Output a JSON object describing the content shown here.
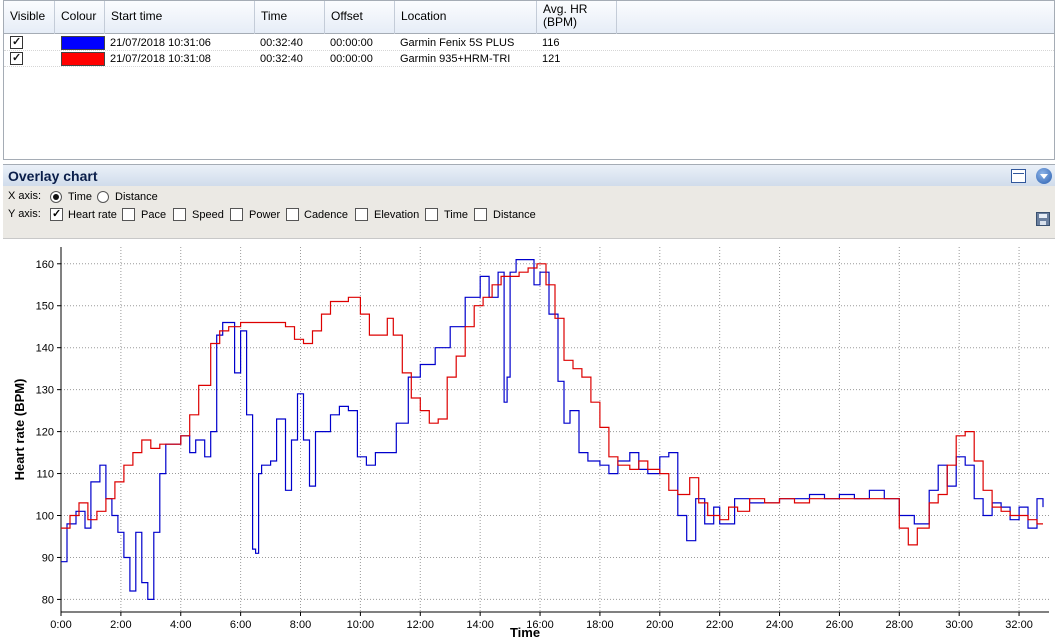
{
  "grid": {
    "columns": [
      {
        "label": "Visible"
      },
      {
        "label": "Colour"
      },
      {
        "label": "Start time"
      },
      {
        "label": "Time"
      },
      {
        "label": "Offset"
      },
      {
        "label": "Location"
      },
      {
        "label_line1": "Avg. HR",
        "label_line2": "(BPM)"
      }
    ],
    "rows": [
      {
        "visible": true,
        "colour": "#0000ff",
        "start_time": "21/07/2018 10:31:06",
        "time": "00:32:40",
        "offset": "00:00:00",
        "location": "Garmin Fenix 5S PLUS",
        "avg_hr": "116"
      },
      {
        "visible": true,
        "colour": "#ff0000",
        "start_time": "21/07/2018 10:31:08",
        "time": "00:32:40",
        "offset": "00:00:00",
        "location": "Garmin 935+HRM-TRI",
        "avg_hr": "121"
      }
    ]
  },
  "panel": {
    "title": "Overlay chart",
    "x_axis_label": "X axis:",
    "x_options": [
      {
        "label": "Time",
        "selected": true
      },
      {
        "label": "Distance",
        "selected": false
      }
    ],
    "y_axis_label": "Y axis:",
    "y_options": [
      {
        "label": "Heart rate",
        "checked": true
      },
      {
        "label": "Pace",
        "checked": false
      },
      {
        "label": "Speed",
        "checked": false
      },
      {
        "label": "Power",
        "checked": false
      },
      {
        "label": "Cadence",
        "checked": false
      },
      {
        "label": "Elevation",
        "checked": false
      },
      {
        "label": "Time",
        "checked": false
      },
      {
        "label": "Distance",
        "checked": false
      }
    ],
    "icons": {
      "window": "window-layout-icon",
      "menu": "chevron-down-icon",
      "save": "save-icon"
    }
  },
  "chart_data": {
    "type": "line",
    "xlabel": "Time",
    "ylabel": "Heart rate (BPM)",
    "x_unit": "minutes",
    "xlim": [
      0,
      33
    ],
    "ylim": [
      77,
      164
    ],
    "grid": true,
    "x_ticks": [
      "0:00",
      "2:00",
      "4:00",
      "6:00",
      "8:00",
      "10:00",
      "12:00",
      "14:00",
      "16:00",
      "18:00",
      "20:00",
      "22:00",
      "24:00",
      "26:00",
      "28:00",
      "30:00",
      "32:00"
    ],
    "y_ticks": [
      80,
      90,
      100,
      110,
      120,
      130,
      140,
      150,
      160
    ],
    "series": [
      {
        "color": "#0000cc",
        "x": [
          0,
          0.2,
          0.5,
          0.8,
          1.0,
          1.3,
          1.5,
          1.7,
          1.9,
          2.1,
          2.3,
          2.5,
          2.7,
          2.9,
          3.1,
          3.3,
          3.5,
          3.8,
          4.0,
          4.3,
          4.5,
          4.8,
          5.0,
          5.2,
          5.4,
          5.6,
          5.8,
          6.0,
          6.2,
          6.4,
          6.5,
          6.6,
          6.7,
          7.0,
          7.2,
          7.5,
          7.7,
          7.9,
          8.1,
          8.3,
          8.5,
          8.7,
          9.0,
          9.3,
          9.6,
          9.9,
          10.2,
          10.5,
          10.8,
          11.2,
          11.6,
          12.0,
          12.5,
          13.0,
          13.5,
          14.0,
          14.3,
          14.6,
          14.8,
          14.9,
          15.0,
          15.2,
          15.5,
          15.8,
          16.0,
          16.3,
          16.6,
          16.8,
          17.0,
          17.3,
          17.6,
          18.0,
          18.3,
          18.6,
          19.0,
          19.3,
          19.6,
          20.0,
          20.3,
          20.6,
          20.9,
          21.2,
          21.5,
          21.8,
          22.0,
          22.5,
          23.0,
          23.5,
          24.0,
          24.5,
          25.0,
          25.5,
          26.0,
          26.5,
          27.0,
          27.5,
          28.0,
          28.5,
          29.0,
          29.3,
          29.6,
          29.9,
          30.2,
          30.5,
          30.8,
          31.1,
          31.4,
          31.7,
          32.0,
          32.3,
          32.6,
          32.8
        ],
        "y": [
          89,
          98,
          101,
          97,
          108,
          112,
          104,
          100,
          96,
          90,
          82,
          96,
          84,
          80,
          96,
          110,
          117,
          117,
          119,
          115,
          118,
          114,
          120,
          143,
          146,
          146,
          134,
          144,
          124,
          92,
          91,
          110,
          112,
          113,
          123,
          106,
          118,
          129,
          118,
          107,
          120,
          120,
          124,
          126,
          125,
          114,
          112,
          115,
          115,
          122,
          133,
          136,
          140,
          145,
          152,
          157,
          152,
          158,
          127,
          133,
          158,
          161,
          161,
          155,
          158,
          148,
          132,
          122,
          125,
          115,
          113,
          112,
          110,
          113,
          115,
          111,
          110,
          114,
          115,
          100,
          94,
          104,
          98,
          102,
          98,
          104,
          103,
          103,
          104,
          104,
          105,
          104,
          105,
          104,
          106,
          104,
          100,
          98,
          106,
          112,
          107,
          114,
          112,
          104,
          100,
          103,
          102,
          99,
          102,
          97,
          104,
          102
        ]
      },
      {
        "color": "#dd0000",
        "x": [
          0,
          0.3,
          0.6,
          0.9,
          1.2,
          1.5,
          1.8,
          2.1,
          2.4,
          2.7,
          3.0,
          3.3,
          3.6,
          4.0,
          4.3,
          4.6,
          5.0,
          5.3,
          5.6,
          6.0,
          6.3,
          6.6,
          6.9,
          7.2,
          7.5,
          7.8,
          8.1,
          8.4,
          8.7,
          9.0,
          9.3,
          9.6,
          10.0,
          10.3,
          10.6,
          10.9,
          11.1,
          11.4,
          11.7,
          12.0,
          12.3,
          12.6,
          12.9,
          13.2,
          13.5,
          13.8,
          14.1,
          14.4,
          14.7,
          15.0,
          15.3,
          15.6,
          15.9,
          16.2,
          16.5,
          16.8,
          17.1,
          17.4,
          17.7,
          18.0,
          18.3,
          18.6,
          19.0,
          19.3,
          19.6,
          20.0,
          20.3,
          20.6,
          21.0,
          21.3,
          21.6,
          22.0,
          22.3,
          22.6,
          23.0,
          23.5,
          24.0,
          24.5,
          25.0,
          25.5,
          26.0,
          26.5,
          27.0,
          27.5,
          28.0,
          28.3,
          28.6,
          29.0,
          29.3,
          29.6,
          29.9,
          30.2,
          30.5,
          30.8,
          31.1,
          31.4,
          31.7,
          32.0,
          32.3,
          32.6,
          32.8
        ],
        "y": [
          97,
          100,
          103,
          99,
          101,
          104,
          108,
          112,
          115,
          118,
          116,
          117,
          117,
          119,
          124,
          131,
          141,
          144,
          145,
          146,
          146,
          146,
          146,
          146,
          145,
          142,
          141,
          144,
          148,
          151,
          151,
          152,
          148,
          143,
          143,
          147,
          143,
          134,
          128,
          125,
          122,
          123,
          133,
          138,
          145,
          150,
          152,
          155,
          157,
          157,
          158,
          159,
          160,
          155,
          147,
          137,
          135,
          133,
          127,
          121,
          114,
          112,
          111,
          113,
          111,
          110,
          106,
          105,
          109,
          103,
          100,
          99,
          102,
          101,
          104,
          103,
          104,
          103,
          104,
          104,
          104,
          104,
          104,
          104,
          97,
          93,
          97,
          103,
          105,
          112,
          119,
          120,
          113,
          106,
          102,
          101,
          100,
          100,
          99,
          98,
          98
        ]
      }
    ]
  }
}
